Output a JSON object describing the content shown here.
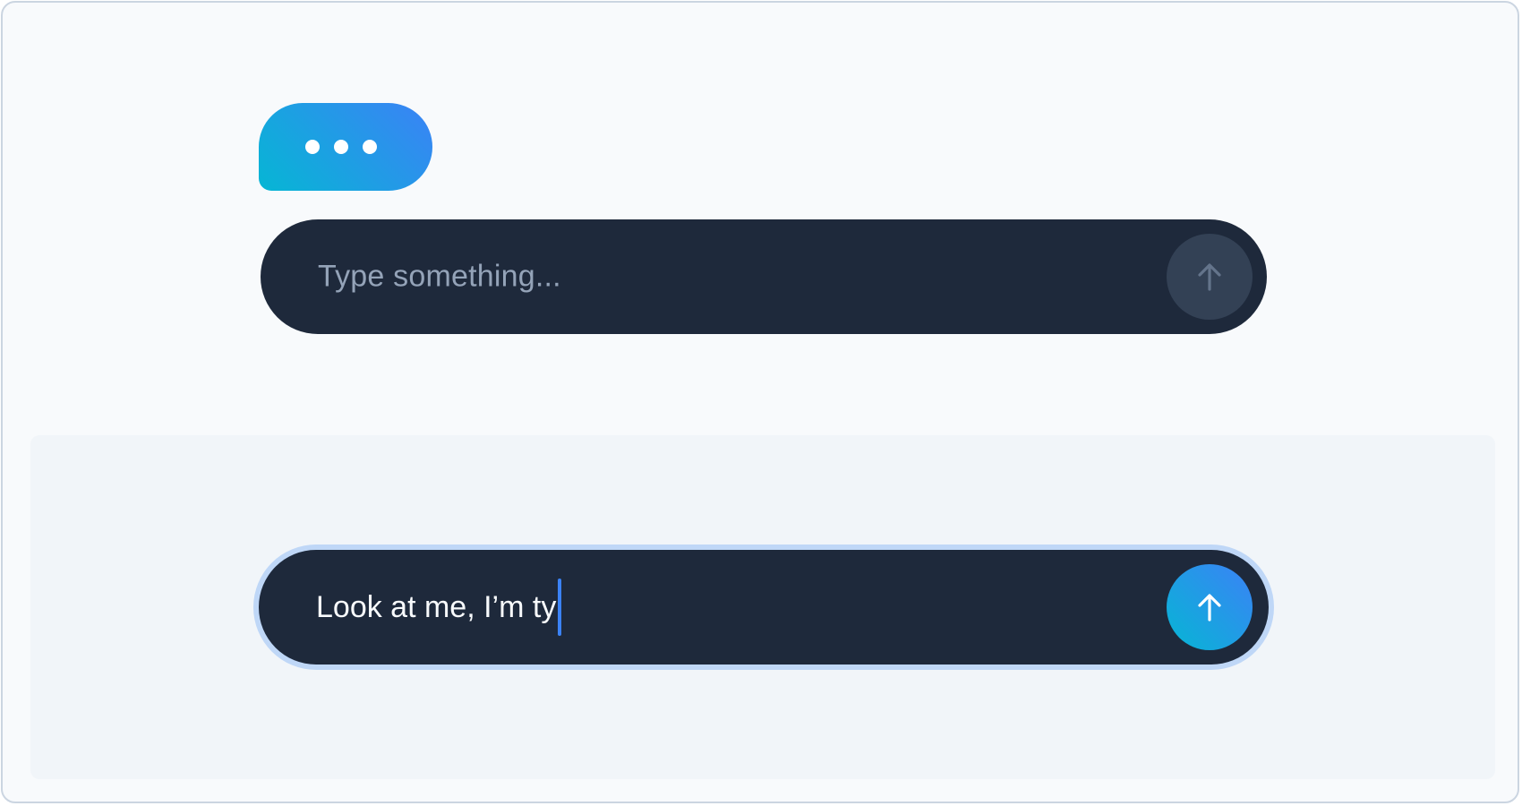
{
  "typing_indicator": {
    "dots": 3,
    "gradient_from": "#06b6d4",
    "gradient_to": "#3b82f6"
  },
  "input_top": {
    "placeholder": "Type something...",
    "send_icon": "arrow-up-icon",
    "state": "empty"
  },
  "input_bottom": {
    "value": "Look at me, I’m ty",
    "send_icon": "arrow-up-icon",
    "state": "focused"
  },
  "colors": {
    "bar_background": "#1e293b",
    "placeholder": "#94a3b8",
    "accent": "#3b82f6",
    "focus_ring": "#bfd7f7"
  }
}
